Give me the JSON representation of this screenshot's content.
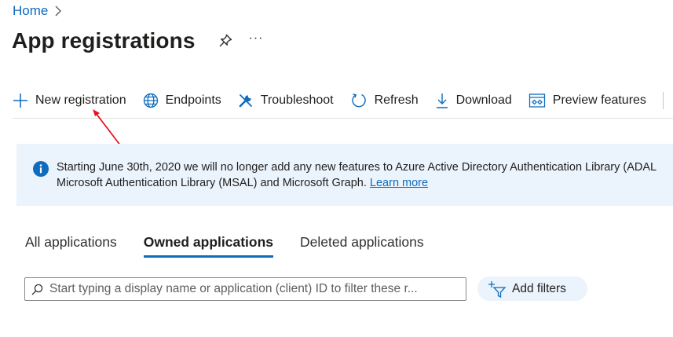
{
  "breadcrumb": {
    "home": "Home"
  },
  "page": {
    "title": "App registrations",
    "more": "···"
  },
  "toolbar": {
    "new_registration": "New registration",
    "endpoints": "Endpoints",
    "troubleshoot": "Troubleshoot",
    "refresh": "Refresh",
    "download": "Download",
    "preview_features": "Preview features"
  },
  "banner": {
    "line1": "Starting June 30th, 2020 we will no longer add any new features to Azure Active Directory Authentication Library (ADAL",
    "line2": "Microsoft Authentication Library (MSAL) and Microsoft Graph. ",
    "link": "Learn more"
  },
  "tabs": [
    {
      "label": "All applications"
    },
    {
      "label": "Owned applications",
      "active": true
    },
    {
      "label": "Deleted applications"
    }
  ],
  "search": {
    "placeholder": "Start typing a display name or application (client) ID to filter these r...",
    "value": ""
  },
  "filters": {
    "label": "Add filters"
  },
  "colors": {
    "accent": "#0f6cbd",
    "banner_bg": "#ebf3fc",
    "annotation_arrow": "#e81123"
  },
  "icons": {
    "new_registration": "plus-icon",
    "endpoints": "globe-icon",
    "troubleshoot": "wrench-icon",
    "refresh": "refresh-icon",
    "download": "download-icon",
    "preview_features": "preview-icon",
    "banner": "info-icon",
    "search": "search-icon",
    "filters": "add-filter-icon"
  }
}
